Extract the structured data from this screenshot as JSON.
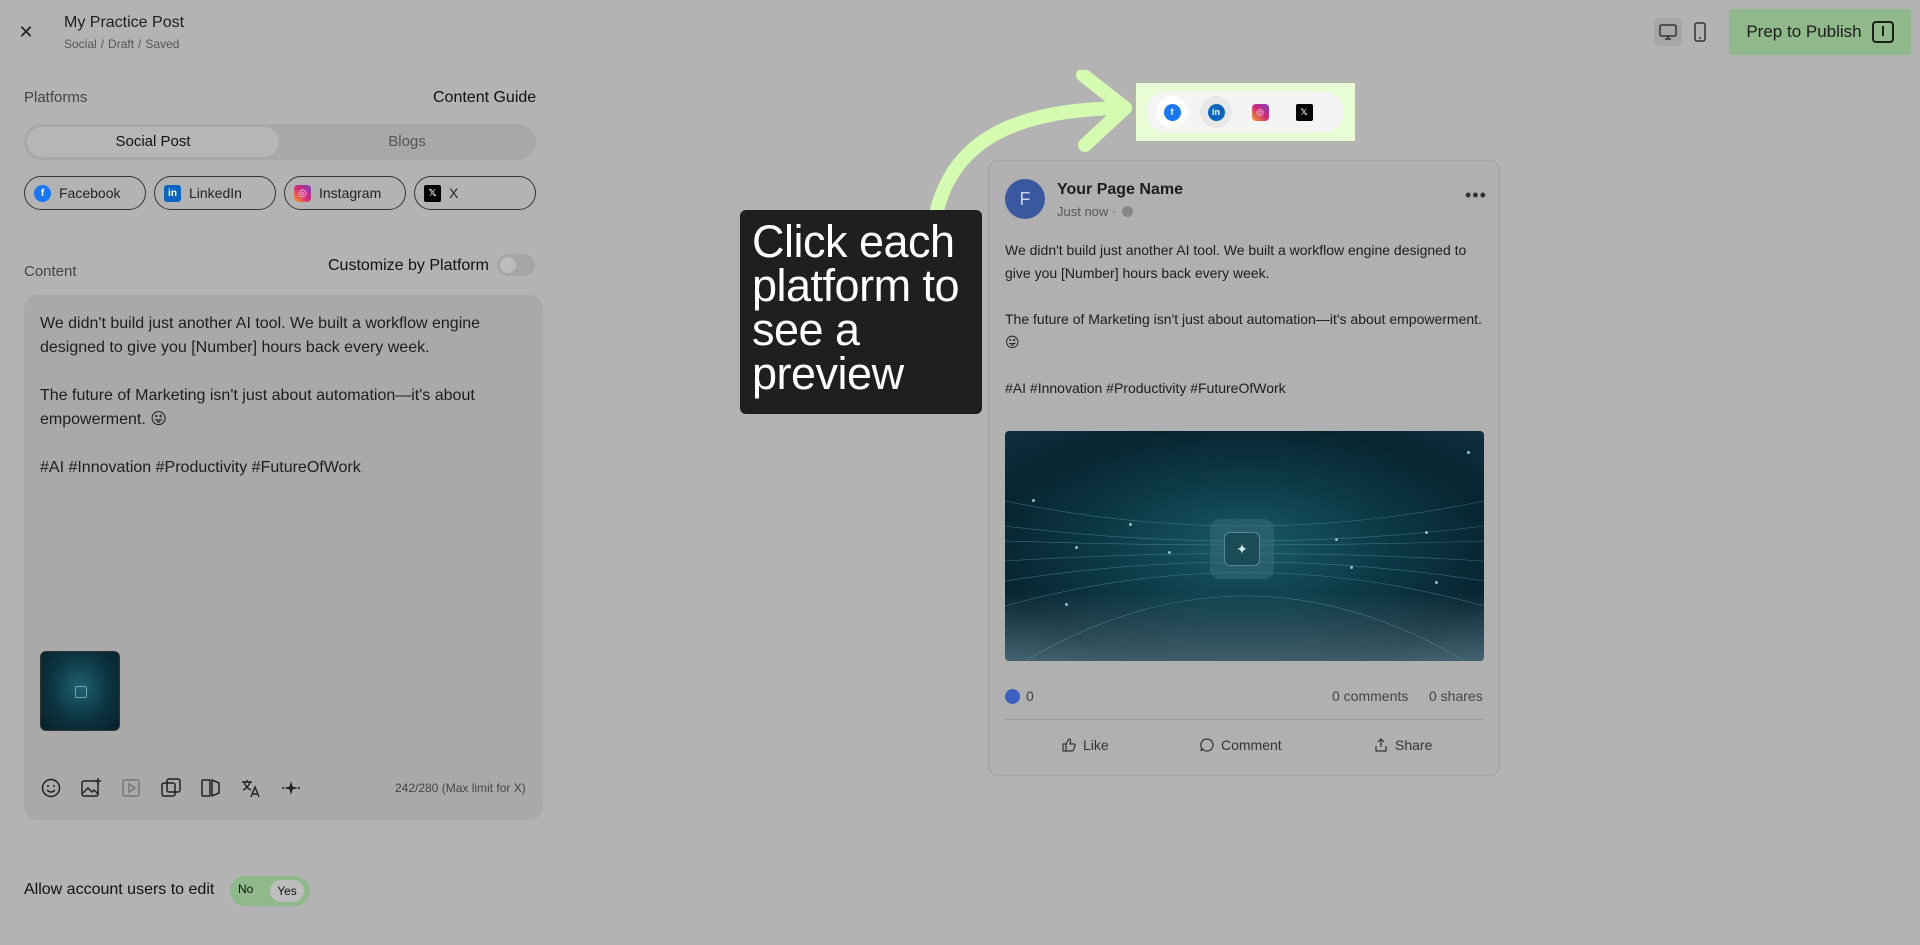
{
  "header": {
    "close_icon": "close-icon",
    "title": "My Practice Post",
    "breadcrumb": [
      "Social",
      "/",
      "Draft",
      "/",
      "Saved"
    ],
    "prep_button": "Prep to Publish"
  },
  "left": {
    "platforms_label": "Platforms",
    "content_guide": "Content Guide",
    "tabs": [
      {
        "label": "Social Post",
        "active": true
      },
      {
        "label": "Blogs",
        "active": false
      }
    ],
    "platform_chips": [
      {
        "label": "Facebook",
        "icon": "facebook-icon",
        "color": "#1877f2"
      },
      {
        "label": "LinkedIn",
        "icon": "linkedin-icon",
        "color": "#0a66c2"
      },
      {
        "label": "Instagram",
        "icon": "instagram-icon",
        "color": "#d62976"
      },
      {
        "label": "X",
        "icon": "x-icon",
        "color": "#000000"
      }
    ],
    "content_label": "Content",
    "customize_label": "Customize by Platform",
    "editor_text": "We didn't build just another AI tool. We built a workflow engine designed to give you [Number] hours back every week.\n\nThe future of Marketing isn't just about automation—it's about empowerment. 😜\n\n#AI #Innovation #Productivity #FutureOfWork",
    "char_count": "242/280 (Max limit for X)",
    "allow_label": "Allow account users to edit",
    "allow_no": "No",
    "allow_yes": "Yes"
  },
  "tooltip": {
    "text": "Click each platform to see a preview"
  },
  "preview": {
    "page_name": "Your Page Name",
    "avatar_letter": "F",
    "time": "Just now ·",
    "post_text": "We didn't build just another AI tool. We built a workflow engine designed to give you [Number] hours back every week.\n\nThe future of Marketing isn't just about automation—it's about empowerment. 😜\n\n#AI #Innovation #Productivity #FutureOfWork",
    "reaction_count": "0",
    "comments": "0 comments",
    "shares": "0 shares",
    "like": "Like",
    "comment": "Comment",
    "share": "Share"
  },
  "colors": {
    "accent": "#8fb98a",
    "highlight": "#e9fdd4",
    "facebook": "#1877f2"
  }
}
